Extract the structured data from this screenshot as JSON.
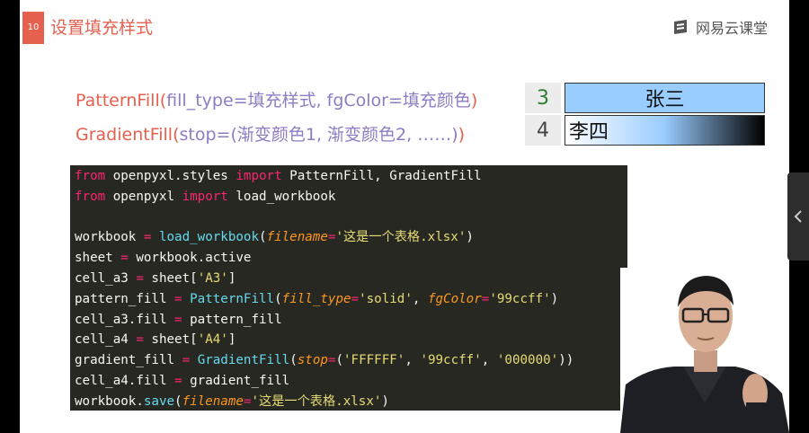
{
  "slide": {
    "number": "10",
    "title": "设置填充样式",
    "brand": "网易云课堂"
  },
  "formulas": {
    "pattern": {
      "fn": "PatternFill",
      "open": "(",
      "args": "fill_type=填充样式, fgColor=填充颜色",
      "close": ")"
    },
    "gradient": {
      "fn": "GradientFill",
      "open": "(",
      "args": "stop=(渐变颜色1, 渐变颜色2, ……)",
      "close": ")"
    }
  },
  "excel": {
    "rows": [
      {
        "num": "3",
        "value": "张三",
        "fill": "#99ccff"
      },
      {
        "num": "4",
        "value": "李四",
        "gradient": [
          "#FFFFFF",
          "#99ccff",
          "#000000"
        ]
      }
    ]
  },
  "code": {
    "lines": [
      [
        [
          "kw",
          "from"
        ],
        [
          "t",
          " openpyxl.styles "
        ],
        [
          "kw",
          "import"
        ],
        [
          "t",
          " PatternFill, GradientFill"
        ]
      ],
      [
        [
          "kw",
          "from"
        ],
        [
          "t",
          " openpyxl "
        ],
        [
          "kw",
          "import"
        ],
        [
          "t",
          " load_workbook"
        ]
      ],
      [],
      [
        [
          "t",
          "workbook "
        ],
        [
          "op",
          "="
        ],
        [
          "t",
          " "
        ],
        [
          "call",
          "load_workbook"
        ],
        [
          "t",
          "("
        ],
        [
          "par",
          "filename"
        ],
        [
          "op",
          "="
        ],
        [
          "str",
          "'这是一个表格.xlsx'"
        ],
        [
          "t",
          ")"
        ]
      ],
      [
        [
          "t",
          "sheet "
        ],
        [
          "op",
          "="
        ],
        [
          "t",
          " workbook.active"
        ]
      ],
      [
        [
          "t",
          "cell_a3 "
        ],
        [
          "op",
          "="
        ],
        [
          "t",
          " sheet["
        ],
        [
          "str",
          "'A3'"
        ],
        [
          "t",
          "]"
        ]
      ],
      [
        [
          "t",
          "pattern_fill "
        ],
        [
          "op",
          "="
        ],
        [
          "t",
          " "
        ],
        [
          "call",
          "PatternFill"
        ],
        [
          "t",
          "("
        ],
        [
          "par",
          "fill_type"
        ],
        [
          "op",
          "="
        ],
        [
          "str",
          "'solid'"
        ],
        [
          "t",
          ", "
        ],
        [
          "par",
          "fgColor"
        ],
        [
          "op",
          "="
        ],
        [
          "str",
          "'99ccff'"
        ],
        [
          "t",
          ")"
        ]
      ],
      [
        [
          "t",
          "cell_a3.fill "
        ],
        [
          "op",
          "="
        ],
        [
          "t",
          " pattern_fill"
        ]
      ],
      [
        [
          "t",
          "cell_a4 "
        ],
        [
          "op",
          "="
        ],
        [
          "t",
          " sheet["
        ],
        [
          "str",
          "'A4'"
        ],
        [
          "t",
          "]"
        ]
      ],
      [
        [
          "t",
          "gradient_fill "
        ],
        [
          "op",
          "="
        ],
        [
          "t",
          " "
        ],
        [
          "call",
          "GradientFill"
        ],
        [
          "t",
          "("
        ],
        [
          "par",
          "stop"
        ],
        [
          "op",
          "="
        ],
        [
          "t",
          "("
        ],
        [
          "str",
          "'FFFFFF'"
        ],
        [
          "t",
          ", "
        ],
        [
          "str",
          "'99ccff'"
        ],
        [
          "t",
          ", "
        ],
        [
          "str",
          "'000000'"
        ],
        [
          "t",
          "))"
        ]
      ],
      [
        [
          "t",
          "cell_a4.fill "
        ],
        [
          "op",
          "="
        ],
        [
          "t",
          " gradient_fill"
        ]
      ],
      [
        [
          "t",
          "workbook."
        ],
        [
          "call",
          "save"
        ],
        [
          "t",
          "("
        ],
        [
          "par",
          "filename"
        ],
        [
          "op",
          "="
        ],
        [
          "str",
          "'这是一个表格.xlsx'"
        ],
        [
          "t",
          ")"
        ]
      ]
    ]
  },
  "icons": {
    "brand": "course-logo-icon",
    "side_toggle": "chevron-left-icon",
    "presenter": "presenter-video"
  },
  "colors": {
    "accent": "#e5604e",
    "arg": "#8e7cc3",
    "code_bg": "#272822"
  }
}
